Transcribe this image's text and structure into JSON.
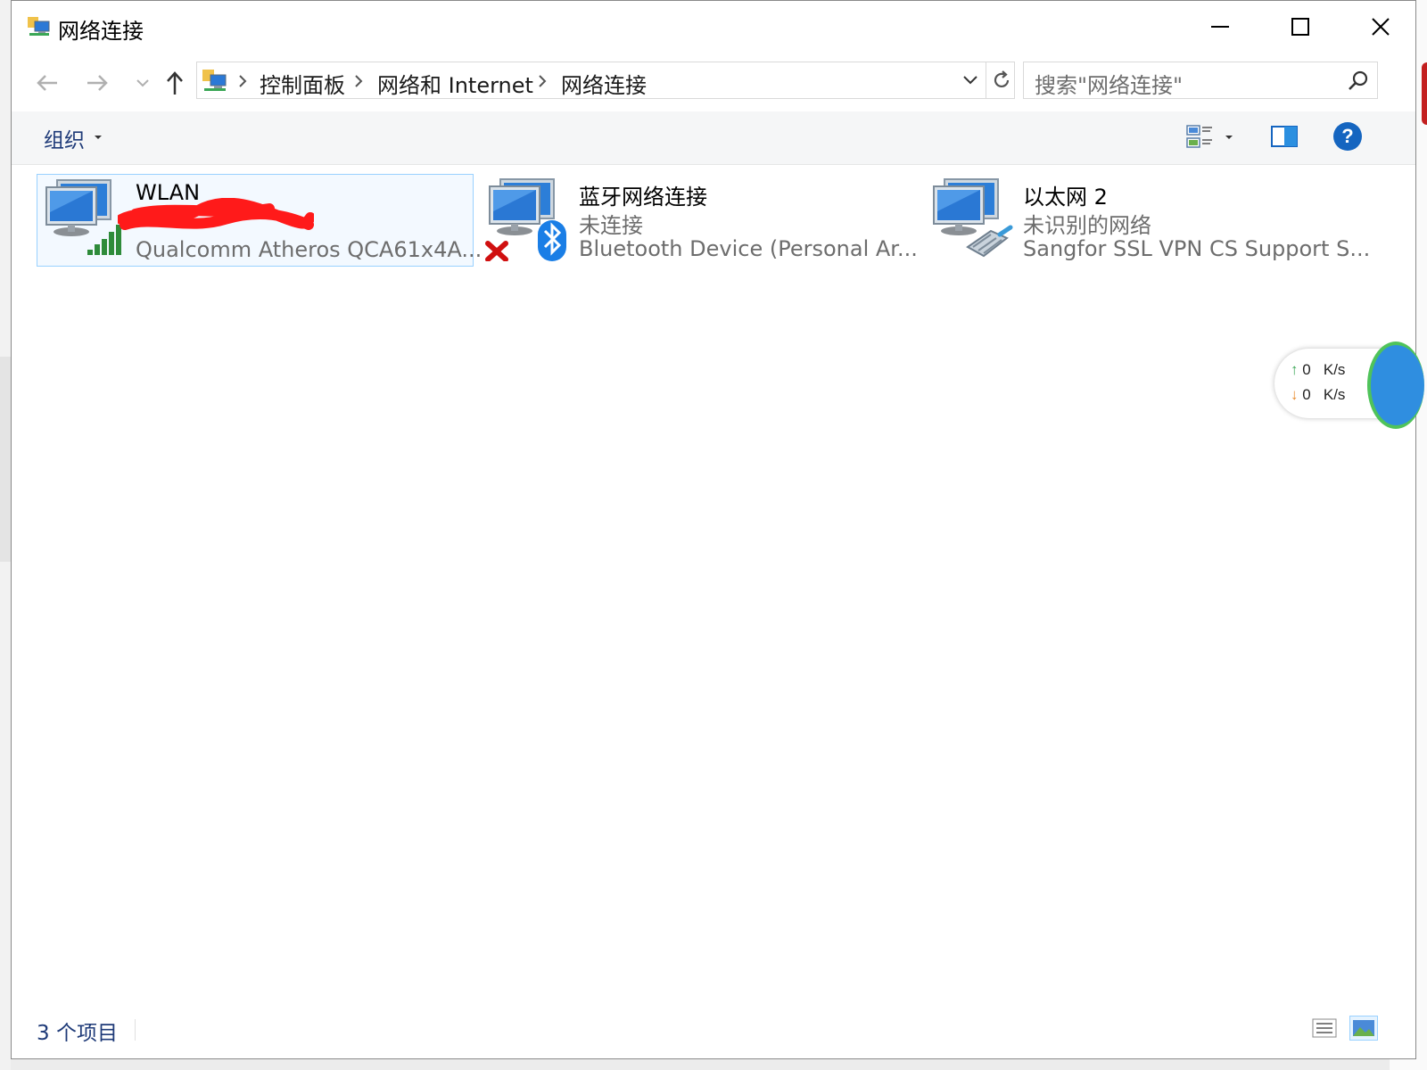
{
  "window": {
    "title": "网络连接",
    "controls": {
      "minimize": "minimize",
      "maximize": "maximize",
      "close": "close"
    }
  },
  "navigation": {
    "breadcrumbs": [
      "控制面板",
      "网络和 Internet",
      "网络连接"
    ],
    "search_placeholder": "搜索\"网络连接\""
  },
  "commandbar": {
    "organize_label": "组织",
    "help_label": "?"
  },
  "connections": [
    {
      "name": "WLAN",
      "status": "",
      "device": "Qualcomm Atheros QCA61x4A...",
      "icon": "wlan-connection-icon",
      "selected": true
    },
    {
      "name": "蓝牙网络连接",
      "status": "未连接",
      "device": "Bluetooth Device (Personal Ar...",
      "icon": "bluetooth-connection-icon",
      "selected": false
    },
    {
      "name": "以太网 2",
      "status": "未识别的网络",
      "device": "Sangfor SSL VPN CS Support S...",
      "icon": "ethernet-connection-icon",
      "selected": false
    }
  ],
  "network_widget": {
    "upload_value": "0",
    "upload_unit": "K/s",
    "download_value": "0",
    "download_unit": "K/s"
  },
  "statusbar": {
    "item_count": "3 个项目"
  },
  "colors": {
    "accent": "#1e3a78",
    "selection_border": "#99d1ff",
    "help_blue": "#1565c0",
    "redaction": "#ff1a1a"
  }
}
